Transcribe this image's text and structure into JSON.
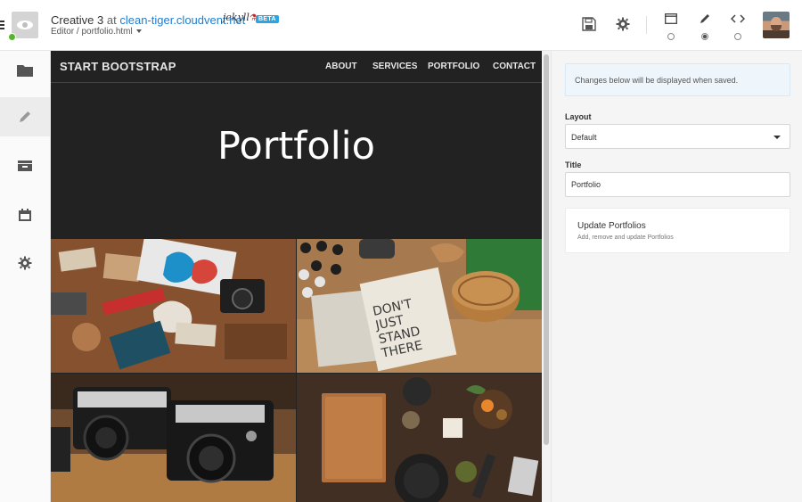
{
  "header": {
    "site_name": "Creative 3",
    "at_word": "at",
    "domain": "clean-tiger.cloudvent.net",
    "ssg_name": "jekyll",
    "beta_badge": "BETA",
    "breadcrumb": "Editor / portfolio.html",
    "modes": [
      {
        "icon": "window-icon",
        "selected": false
      },
      {
        "icon": "pencil-icon",
        "selected": true
      },
      {
        "icon": "code-icon",
        "selected": false
      }
    ]
  },
  "sidebar": {
    "items": [
      {
        "icon": "folder-icon",
        "active": false
      },
      {
        "icon": "pencil-icon",
        "active": true
      },
      {
        "icon": "inbox-icon",
        "active": false
      },
      {
        "icon": "calendar-icon",
        "active": false
      },
      {
        "icon": "gear-icon",
        "active": false
      }
    ]
  },
  "preview": {
    "brand": "START BOOTSTRAP",
    "nav": [
      "ABOUT",
      "SERVICES",
      "PORTFOLIO",
      "CONTACT"
    ],
    "hero_title": "Portfolio",
    "tile_images": [
      "branding-flatlay",
      "dont-just-stand-there-book",
      "vintage-cameras",
      "kitchen-spices"
    ]
  },
  "panel": {
    "notice": "Changes below will be displayed when saved.",
    "layout": {
      "label": "Layout",
      "value": "Default"
    },
    "title": {
      "label": "Title",
      "value": "Portfolio"
    },
    "card": {
      "title": "Update Portfolios",
      "subtitle": "Add, remove and update Portfolios"
    }
  },
  "colors": {
    "accent_link": "#1f7ed0",
    "beta_badge": "#2ca5e0",
    "status_ok": "#58b22e",
    "preview_bg": "#222222"
  }
}
